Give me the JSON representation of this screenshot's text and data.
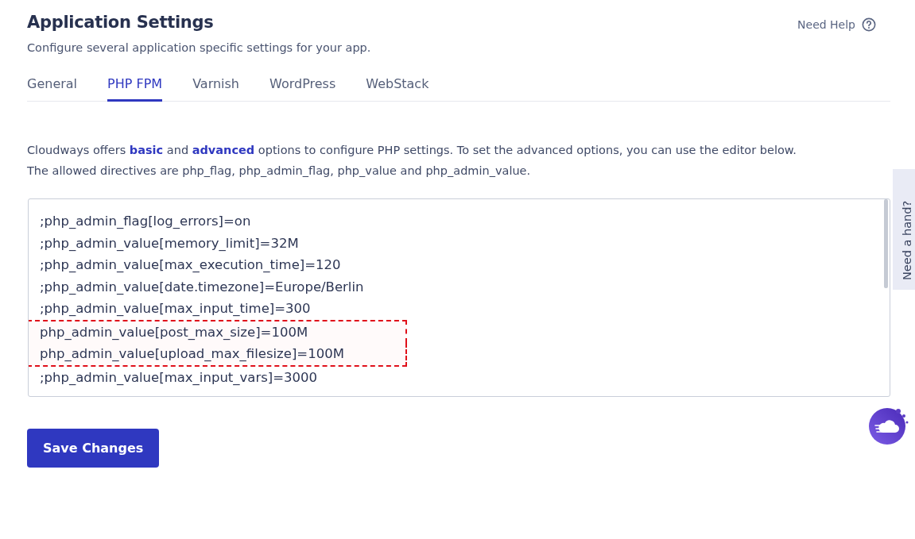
{
  "header": {
    "title": "Application Settings",
    "subtitle": "Configure several application specific settings for your app.",
    "help_link": "Need Help"
  },
  "tabs": [
    {
      "label": "General",
      "selected": false
    },
    {
      "label": "PHP FPM",
      "selected": true
    },
    {
      "label": "Varnish",
      "selected": false
    },
    {
      "label": "WordPress",
      "selected": false
    },
    {
      "label": "WebStack",
      "selected": false
    }
  ],
  "description": [
    "Cloudways offers **basic** and **advanced** options to configure PHP settings. To set the advanced options, you can use the editor below.",
    "The allowed directives are php_flag, php_admin_flag, php_value and php_admin_value."
  ],
  "editor": {
    "lines": [
      {
        "text": ";php_admin_flag[log_errors]=on",
        "highlighted": false
      },
      {
        "text": ";php_admin_value[memory_limit]=32M",
        "highlighted": false
      },
      {
        "text": ";php_admin_value[max_execution_time]=120",
        "highlighted": false
      },
      {
        "text": ";php_admin_value[date.timezone]=Europe/Berlin",
        "highlighted": false
      },
      {
        "text": ";php_admin_value[max_input_time]=300",
        "highlighted": false
      },
      {
        "text": "php_admin_value[post_max_size]=100M",
        "highlighted": true
      },
      {
        "text": "php_admin_value[upload_max_filesize]=100M",
        "highlighted": true
      },
      {
        "text": ";php_admin_value[max_input_vars]=3000",
        "highlighted": false
      }
    ]
  },
  "save_button": "Save Changes",
  "side_tab": "Need a hand?"
}
